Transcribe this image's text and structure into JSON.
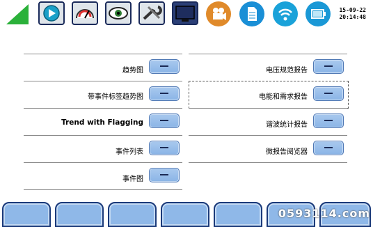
{
  "clock": {
    "date": "15-09-22",
    "time": "20:14:48"
  },
  "toolbar": {
    "icons": [
      "signal-icon",
      "play-icon",
      "gauge-icon",
      "eye-icon",
      "wrench-icon",
      "monitor-icon",
      "camera-icon",
      "document-icon",
      "wifi-icon",
      "battery-icon"
    ]
  },
  "left_menu": [
    {
      "label": "趋势图",
      "button": "−"
    },
    {
      "label": "带事件标签趋势图",
      "button": "−"
    },
    {
      "label": "Trend with Flagging",
      "button": "−"
    },
    {
      "label": "事件列表",
      "button": "−"
    },
    {
      "label": "事件图",
      "button": "−"
    }
  ],
  "right_menu": [
    {
      "label": "电压规范报告",
      "button": "−"
    },
    {
      "label": "电能和需求报告",
      "button": "−"
    },
    {
      "label": "谐波统计报告",
      "button": "−"
    },
    {
      "label": "微报告阅览器",
      "button": "−"
    }
  ],
  "watermark": "0593114.com"
}
